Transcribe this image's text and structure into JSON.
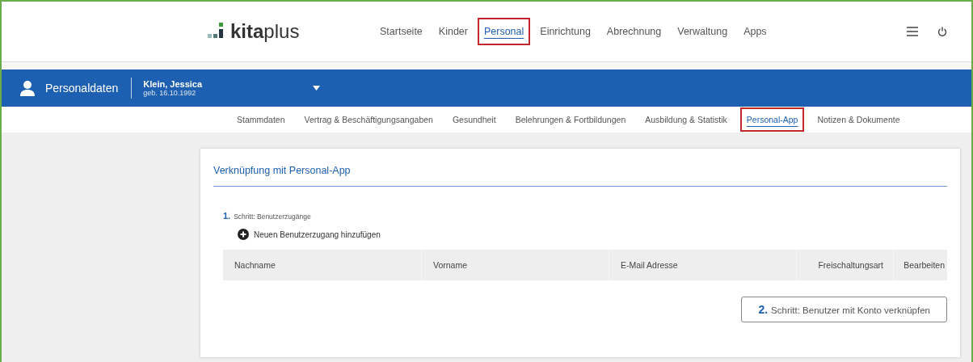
{
  "logo": "**kita**plus",
  "nav": [
    {
      "label": "Startseite",
      "selected": false,
      "highlighted": false
    },
    {
      "label": "Kinder",
      "selected": false,
      "highlighted": false
    },
    {
      "label": "Personal",
      "selected": true,
      "highlighted": true
    },
    {
      "label": "Einrichtung",
      "selected": false,
      "highlighted": false
    },
    {
      "label": "Abrechnung",
      "selected": false,
      "highlighted": false
    },
    {
      "label": "Verwaltung",
      "selected": false,
      "highlighted": false
    },
    {
      "label": "Apps",
      "selected": false,
      "highlighted": false
    }
  ],
  "header": {
    "title": "Personaldaten",
    "person_name": "Klein, Jessica",
    "person_birth": "geb. 16.10.1992"
  },
  "subtabs": [
    {
      "label": "Stammdaten",
      "selected": false,
      "highlighted": false
    },
    {
      "label": "Vertrag & Beschäftigungsangaben",
      "selected": false,
      "highlighted": false
    },
    {
      "label": "Gesundheit",
      "selected": false,
      "highlighted": false
    },
    {
      "label": "Belehrungen & Fortbildungen",
      "selected": false,
      "highlighted": false
    },
    {
      "label": "Ausbildung & Statistik",
      "selected": false,
      "highlighted": false
    },
    {
      "label": "Personal-App",
      "selected": true,
      "highlighted": true
    },
    {
      "label": "Notizen & Dokumente",
      "selected": false,
      "highlighted": false
    }
  ],
  "card": {
    "title": "Verknüpfung mit Personal-App",
    "step1": {
      "number": "1.",
      "label": "Schritt: Benutzerzugänge"
    },
    "add_link": "Neuen Benutzerzugang hinzufügen",
    "table": {
      "columns": [
        "Nachname",
        "Vorname",
        "E-Mail Adresse",
        "Freischaltungsart",
        "Bearbeiten"
      ]
    },
    "step2": {
      "number": "2.",
      "label": "Schritt: Benutzer mit Konto verknüpfen"
    }
  }
}
